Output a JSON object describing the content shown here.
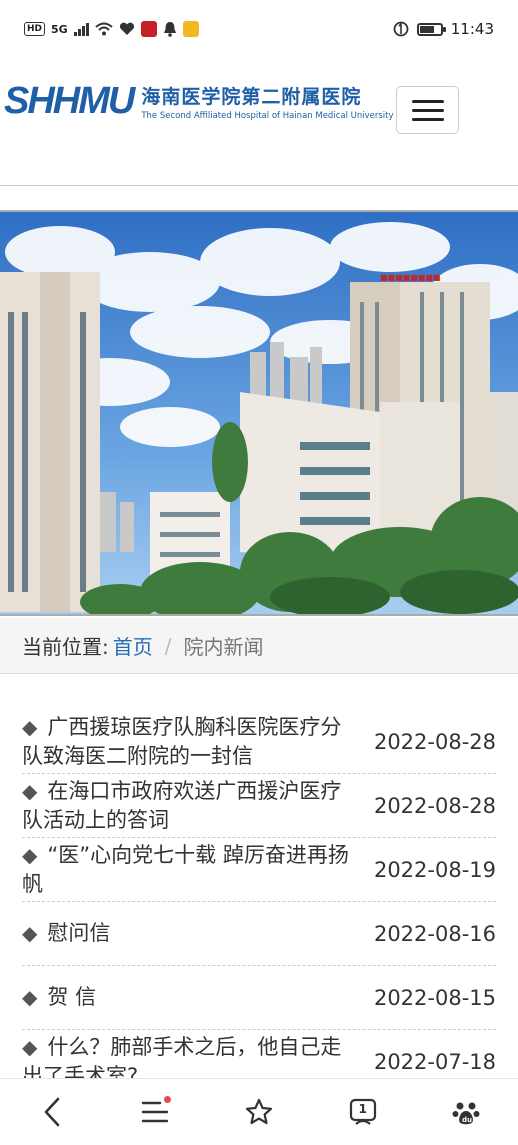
{
  "status_bar": {
    "network": "HD",
    "signal": "5G",
    "time": "11:43"
  },
  "header": {
    "logo_mark": "SHHMU",
    "logo_cn": "海南医学院第二附属医院",
    "logo_en": "The Second Affiliated Hospital of Hainan Medical University",
    "menu_icon": "hamburger-icon"
  },
  "banner": {
    "label": "hospital-campus-photo",
    "colors": {
      "sky": "#3d7fd0",
      "cloud": "#ffffff",
      "building": "#e9e4dc",
      "trees": "#3c7a3a"
    }
  },
  "breadcrumb": {
    "label": "当前位置:",
    "home": "首页",
    "separator": "/",
    "current": "院内新闻"
  },
  "news": [
    {
      "title": "广西援琼医疗队胸科医院医疗分队致海医二附院的一封信",
      "date": "2022-08-28"
    },
    {
      "title": "在海口市政府欢送广西援沪医疗队活动上的答词",
      "date": "2022-08-28"
    },
    {
      "title": "“医”心向党七十载 踔厉奋进再扬帆",
      "date": "2022-08-19"
    },
    {
      "title": "慰问信",
      "date": "2022-08-16"
    },
    {
      "title": "贺 信",
      "date": "2022-08-15"
    },
    {
      "title": "什么？肺部手术之后，他自己走出了手术室?",
      "date": "2022-07-18"
    }
  ],
  "bottom_nav": {
    "back": "chevron-left-icon",
    "menu": "menu-icon",
    "favorite": "star-icon",
    "tabs": "1",
    "home": "paw-icon"
  }
}
